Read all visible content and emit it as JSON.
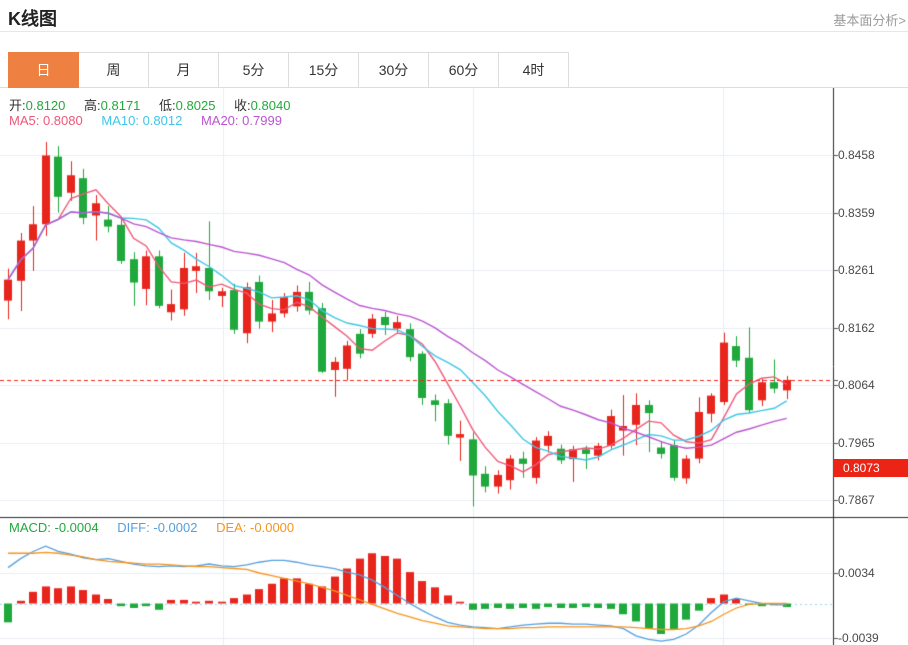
{
  "header": {
    "title": "K线图",
    "link": "基本面分析>"
  },
  "tabs": {
    "items": [
      {
        "label": "日",
        "active": true
      },
      {
        "label": "周",
        "active": false
      },
      {
        "label": "月",
        "active": false
      },
      {
        "label": "5分",
        "active": false
      },
      {
        "label": "15分",
        "active": false
      },
      {
        "label": "30分",
        "active": false
      },
      {
        "label": "60分",
        "active": false
      },
      {
        "label": "4时",
        "active": false
      }
    ]
  },
  "quote": {
    "open_label": "开:",
    "open": "0.8120",
    "high_label": "高:",
    "high": "0.8171",
    "low_label": "低:",
    "low": "0.8025",
    "close_label": "收:",
    "close": "0.8040",
    "ma5_label": "MA5:",
    "ma5": "0.8080",
    "ma10_label": "MA10:",
    "ma10": "0.8012",
    "ma20_label": "MA20:",
    "ma20": "0.7999"
  },
  "macd_header": {
    "macd_label": "MACD:",
    "macd": "-0.0004",
    "diff_label": "DIFF:",
    "diff": "-0.0002",
    "dea_label": "DEA:",
    "dea": "-0.0000"
  },
  "colors": {
    "up": "#e8251d",
    "down": "#1fa83c",
    "ma5": "#ef5878",
    "ma10": "#3fc6e8",
    "ma20": "#bb55d0",
    "diff_line": "#55a0e0",
    "dea_line": "#f7941d",
    "grid": "#e9eef4",
    "axis": "#3a3a3a",
    "price_line": "#f5271c",
    "zero_line": "#9fd6ea",
    "badge_bg": "#ec2415",
    "active_tab": "#ee8041"
  },
  "chart_data": {
    "type": "candlestick",
    "title": "K线图 daily candlestick with MACD",
    "price_axis": {
      "ticks": [
        "0.8458",
        "0.8359",
        "0.8261",
        "0.8162",
        "0.8064",
        "0.7965",
        "0.7867"
      ]
    },
    "last_price": "0.8073",
    "candles_ohlc": [
      [
        0.8209,
        0.8264,
        0.8177,
        0.8245
      ],
      [
        0.8243,
        0.8325,
        0.8191,
        0.8312
      ],
      [
        0.8312,
        0.8371,
        0.826,
        0.834
      ],
      [
        0.834,
        0.8481,
        0.832,
        0.8458
      ],
      [
        0.8456,
        0.8474,
        0.836,
        0.8387
      ],
      [
        0.8394,
        0.8448,
        0.838,
        0.8424
      ],
      [
        0.8419,
        0.8435,
        0.834,
        0.8351
      ],
      [
        0.8355,
        0.839,
        0.8312,
        0.8376
      ],
      [
        0.8348,
        0.8371,
        0.8326,
        0.8336
      ],
      [
        0.8339,
        0.8352,
        0.8272,
        0.8277
      ],
      [
        0.828,
        0.8292,
        0.82,
        0.824
      ],
      [
        0.8229,
        0.8295,
        0.8201,
        0.8285
      ],
      [
        0.8285,
        0.8295,
        0.8196,
        0.82
      ],
      [
        0.8189,
        0.8228,
        0.8175,
        0.8203
      ],
      [
        0.8194,
        0.8291,
        0.8183,
        0.8265
      ],
      [
        0.826,
        0.8291,
        0.8222,
        0.8268
      ],
      [
        0.8265,
        0.8345,
        0.821,
        0.8225
      ],
      [
        0.8217,
        0.8231,
        0.8198,
        0.8225
      ],
      [
        0.8227,
        0.8238,
        0.8152,
        0.8159
      ],
      [
        0.8153,
        0.824,
        0.8136,
        0.8232
      ],
      [
        0.8241,
        0.8252,
        0.8161,
        0.8173
      ],
      [
        0.8173,
        0.821,
        0.8155,
        0.8187
      ],
      [
        0.8187,
        0.8222,
        0.818,
        0.8215
      ],
      [
        0.8199,
        0.8235,
        0.819,
        0.8224
      ],
      [
        0.8224,
        0.8241,
        0.8185,
        0.8192
      ],
      [
        0.8196,
        0.8205,
        0.8085,
        0.8087
      ],
      [
        0.809,
        0.8112,
        0.8044,
        0.8104
      ],
      [
        0.8092,
        0.814,
        0.8072,
        0.8132
      ],
      [
        0.8152,
        0.816,
        0.811,
        0.8118
      ],
      [
        0.8152,
        0.8186,
        0.8145,
        0.8178
      ],
      [
        0.8181,
        0.819,
        0.815,
        0.8167
      ],
      [
        0.8161,
        0.8183,
        0.8155,
        0.8172
      ],
      [
        0.816,
        0.817,
        0.8105,
        0.8112
      ],
      [
        0.8118,
        0.8122,
        0.803,
        0.8042
      ],
      [
        0.8038,
        0.8048,
        0.8002,
        0.803
      ],
      [
        0.8033,
        0.804,
        0.7962,
        0.7977
      ],
      [
        0.7974,
        0.8003,
        0.7934,
        0.798
      ],
      [
        0.7971,
        0.7983,
        0.7856,
        0.7909
      ],
      [
        0.7912,
        0.7925,
        0.788,
        0.789
      ],
      [
        0.789,
        0.7918,
        0.7878,
        0.791
      ],
      [
        0.7901,
        0.7944,
        0.7885,
        0.7938
      ],
      [
        0.7938,
        0.795,
        0.7905,
        0.7929
      ],
      [
        0.7905,
        0.7975,
        0.7895,
        0.7969
      ],
      [
        0.796,
        0.7985,
        0.7948,
        0.7977
      ],
      [
        0.7955,
        0.7962,
        0.7929,
        0.7935
      ],
      [
        0.7937,
        0.796,
        0.7898,
        0.7954
      ],
      [
        0.7954,
        0.796,
        0.792,
        0.7946
      ],
      [
        0.7943,
        0.7965,
        0.7935,
        0.796
      ],
      [
        0.796,
        0.8022,
        0.7955,
        0.8011
      ],
      [
        0.7986,
        0.8047,
        0.7943,
        0.7994
      ],
      [
        0.7996,
        0.805,
        0.7961,
        0.803
      ],
      [
        0.803,
        0.8038,
        0.7949,
        0.8016
      ],
      [
        0.7957,
        0.7968,
        0.7938,
        0.7946
      ],
      [
        0.7961,
        0.797,
        0.79,
        0.7905
      ],
      [
        0.7904,
        0.7944,
        0.7895,
        0.7938
      ],
      [
        0.7938,
        0.8043,
        0.793,
        0.8018
      ],
      [
        0.8015,
        0.805,
        0.8,
        0.8046
      ],
      [
        0.8035,
        0.8154,
        0.803,
        0.8137
      ],
      [
        0.8131,
        0.8148,
        0.8095,
        0.8106
      ],
      [
        0.8111,
        0.8163,
        0.8015,
        0.8021
      ],
      [
        0.8038,
        0.8075,
        0.8028,
        0.8069
      ],
      [
        0.8069,
        0.8108,
        0.805,
        0.8058
      ],
      [
        0.8055,
        0.808,
        0.804,
        0.8073
      ]
    ],
    "macd": {
      "axis_ticks": [
        {
          "label": "0.0034",
          "value": 0.0034
        },
        {
          "label": "-0.0039",
          "value": -0.0039
        }
      ],
      "hist": [
        -0.0021,
        0.0003,
        0.0013,
        0.0019,
        0.0017,
        0.0019,
        0.0015,
        0.001,
        0.0005,
        -0.0003,
        -0.0005,
        -0.0003,
        -0.0007,
        0.0004,
        0.0004,
        0.0002,
        0.0003,
        0.0002,
        0.0006,
        0.001,
        0.0016,
        0.0022,
        0.0028,
        0.0028,
        0.0022,
        0.0019,
        0.003,
        0.0039,
        0.005,
        0.0056,
        0.0053,
        0.005,
        0.0035,
        0.0025,
        0.0018,
        0.0009,
        0.0002,
        -0.0007,
        -0.0006,
        -0.0005,
        -0.0006,
        -0.0005,
        -0.0006,
        -0.0004,
        -0.0005,
        -0.0005,
        -0.0004,
        -0.0005,
        -0.0006,
        -0.0012,
        -0.002,
        -0.0028,
        -0.0034,
        -0.0029,
        -0.0018,
        -0.0008,
        0.0006,
        0.001,
        0.0005,
        -0.0001,
        -0.0003,
        -0.0002,
        -0.0004
      ],
      "diff": [
        0.004,
        0.005,
        0.0058,
        0.0064,
        0.0058,
        0.0055,
        0.0051,
        0.0049,
        0.005,
        0.0047,
        0.0044,
        0.0042,
        0.0041,
        0.0042,
        0.0041,
        0.0042,
        0.0044,
        0.0042,
        0.0041,
        0.0043,
        0.0046,
        0.0048,
        0.0048,
        0.0046,
        0.0043,
        0.0041,
        0.0039,
        0.0035,
        0.0032,
        0.0026,
        0.0018,
        0.0009,
        0.0,
        -0.0008,
        -0.0015,
        -0.0021,
        -0.0024,
        -0.0026,
        -0.0027,
        -0.0028,
        -0.0026,
        -0.0024,
        -0.0023,
        -0.0022,
        -0.0022,
        -0.0023,
        -0.0023,
        -0.0024,
        -0.0025,
        -0.0028,
        -0.0036,
        -0.004,
        -0.0042,
        -0.004,
        -0.0034,
        -0.0024,
        -0.001,
        0.0002,
        0.0006,
        0.0003,
        0.0,
        -0.0001,
        -0.0002
      ],
      "dea": [
        0.0056,
        0.0056,
        0.0056,
        0.0057,
        0.0056,
        0.0054,
        0.0052,
        0.0049,
        0.0047,
        0.0046,
        0.0045,
        0.0044,
        0.0044,
        0.0043,
        0.0042,
        0.0041,
        0.0041,
        0.004,
        0.0039,
        0.0038,
        0.0034,
        0.0031,
        0.0028,
        0.0025,
        0.0022,
        0.0018,
        0.0014,
        0.0009,
        0.0004,
        -0.0001,
        -0.0006,
        -0.0011,
        -0.0015,
        -0.0019,
        -0.0022,
        -0.0025,
        -0.0026,
        -0.0027,
        -0.0028,
        -0.0028,
        -0.0028,
        -0.0027,
        -0.0027,
        -0.0026,
        -0.0026,
        -0.0026,
        -0.0026,
        -0.0026,
        -0.0026,
        -0.0026,
        -0.0027,
        -0.0028,
        -0.0029,
        -0.0029,
        -0.0028,
        -0.0025,
        -0.002,
        -0.0012,
        -0.0005,
        -0.0001,
        0.0,
        0.0,
        0.0
      ]
    }
  }
}
